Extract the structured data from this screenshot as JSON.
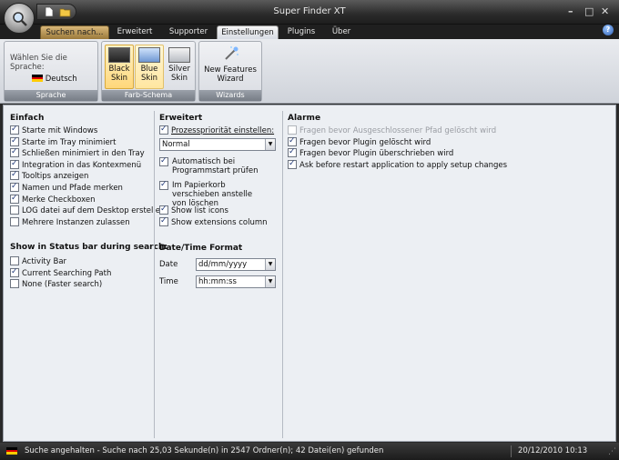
{
  "window": {
    "title": "Super Finder XT"
  },
  "tabs": [
    "Suchen nach...",
    "Erweitert",
    "Supporter",
    "Einstellungen",
    "Plugins",
    "Über"
  ],
  "ribbon": {
    "sprache": {
      "prompt": "Wählen Sie die Sprache:",
      "language": "Deutsch",
      "group_title": "Sprache"
    },
    "skins": {
      "black": [
        "Black",
        "Skin"
      ],
      "blue": [
        "Blue",
        "Skin"
      ],
      "silver": [
        "Silver",
        "Skin"
      ],
      "group_title": "Farb-Schema"
    },
    "wizards": {
      "label": [
        "New Features",
        "Wizard"
      ],
      "group_title": "Wizards"
    }
  },
  "einfach": {
    "heading": "Einfach",
    "items": [
      {
        "label": "Starte mit Windows",
        "checked": true
      },
      {
        "label": "Starte im Tray minimiert",
        "checked": true
      },
      {
        "label": "Schließen minimiert in den Tray",
        "checked": true
      },
      {
        "label": "Integration in das Kontexmenü",
        "checked": true
      },
      {
        "label": "Tooltips anzeigen",
        "checked": true
      },
      {
        "label": "Namen und Pfade merken",
        "checked": true
      },
      {
        "label": "Merke Checkboxen",
        "checked": true
      },
      {
        "label": "LOG datei auf dem Desktop erstellen",
        "checked": false
      },
      {
        "label": "Mehrere Instanzen zulassen",
        "checked": false
      }
    ]
  },
  "statusbar_options": {
    "heading": "Show in Status bar during search:",
    "items": [
      {
        "label": "Activity Bar",
        "checked": false
      },
      {
        "label": "Current Searching Path",
        "checked": true
      },
      {
        "label": "None (Faster search)",
        "checked": false
      }
    ]
  },
  "erweitert": {
    "heading": "Erweitert",
    "priority_label": "Prozesspriorität einstellen:",
    "priority_checked": true,
    "priority_value": "Normal",
    "items": [
      {
        "label": "Automatisch bei Programmstart prüfen",
        "checked": true
      },
      {
        "label": "Im Papierkorb verschieben anstelle von löschen",
        "checked": true
      },
      {
        "label": "Show list icons",
        "checked": true
      },
      {
        "label": "Show extensions column",
        "checked": true
      }
    ]
  },
  "datetime": {
    "heading": "Date/Time Format",
    "date_label": "Date",
    "date_value": "dd/mm/yyyy",
    "time_label": "Time",
    "time_value": "hh:mm:ss"
  },
  "alarme": {
    "heading": "Alarme",
    "items": [
      {
        "label": "Fragen bevor Ausgeschlossener Pfad gelöscht wird",
        "checked": false,
        "disabled": true
      },
      {
        "label": "Fragen bevor Plugin gelöscht wird",
        "checked": true
      },
      {
        "label": "Fragen bevor Plugin überschrieben wird",
        "checked": true
      },
      {
        "label": "Ask before restart application to apply setup changes",
        "checked": true
      }
    ]
  },
  "statusbar": {
    "message": "Suche angehalten - Suche nach 25,03 Sekunde(n) in 2547 Ordner(n); 42 Datei(en) gefunden",
    "datetime": "20/12/2010 10:13"
  },
  "colors": {
    "accent_tab": "#c9a35a",
    "titlebar": "#2b2b2b",
    "panel": "#eceff3"
  }
}
